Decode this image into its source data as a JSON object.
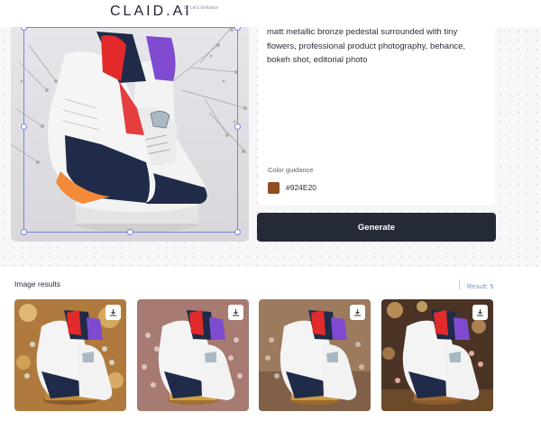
{
  "header": {
    "logo": "CLAID.AI",
    "logo_sub": "by Let's Enhance"
  },
  "prompt": {
    "text": "matt metallic bronze pedestal surrounded with tiny flowers, professional product photography, behance, bokeh shot, editorial photo"
  },
  "color_guidance": {
    "label": "Color guidance",
    "hex": "#924E20"
  },
  "generate_button": {
    "label": "Generate"
  },
  "results": {
    "title": "Image results",
    "count_label": "Result: 5",
    "thumbnails": [
      {
        "background": "bokeh-gold"
      },
      {
        "background": "mauve-flowers"
      },
      {
        "background": "warm-tan"
      },
      {
        "background": "dark-bokeh"
      }
    ]
  },
  "icons": [
    "download-icon"
  ]
}
